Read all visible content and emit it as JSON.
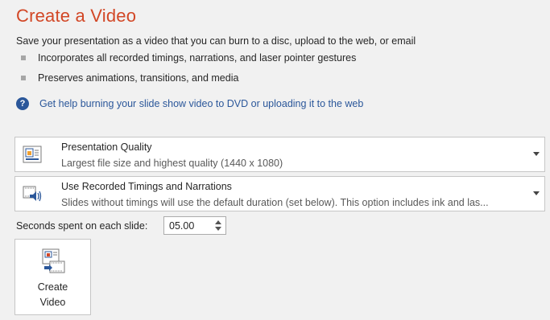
{
  "page": {
    "title": "Create a Video",
    "subtitle": "Save your presentation as a video that you can burn to a disc, upload to the web, or email",
    "bullets": [
      "Incorporates all recorded timings, narrations, and laser pointer gestures",
      "Preserves animations, transitions, and media"
    ],
    "help_link": "Get help burning your slide show video to DVD or uploading it to the web"
  },
  "quality_dropdown": {
    "title": "Presentation Quality",
    "description": "Largest file size and highest quality (1440 x 1080)",
    "icon": "presentation-quality-icon"
  },
  "timings_dropdown": {
    "title": "Use Recorded Timings and Narrations",
    "description": "Slides without timings will use the default duration (set below). This option includes ink and las...",
    "icon": "timings-narrations-icon"
  },
  "seconds": {
    "label": "Seconds spent on each slide:",
    "value": "05.00"
  },
  "create_button": {
    "label_line1": "Create",
    "label_line2": "Video",
    "icon": "create-video-icon"
  },
  "colors": {
    "title": "#d24726",
    "link": "#2b579a",
    "background": "#f1f1f1"
  }
}
